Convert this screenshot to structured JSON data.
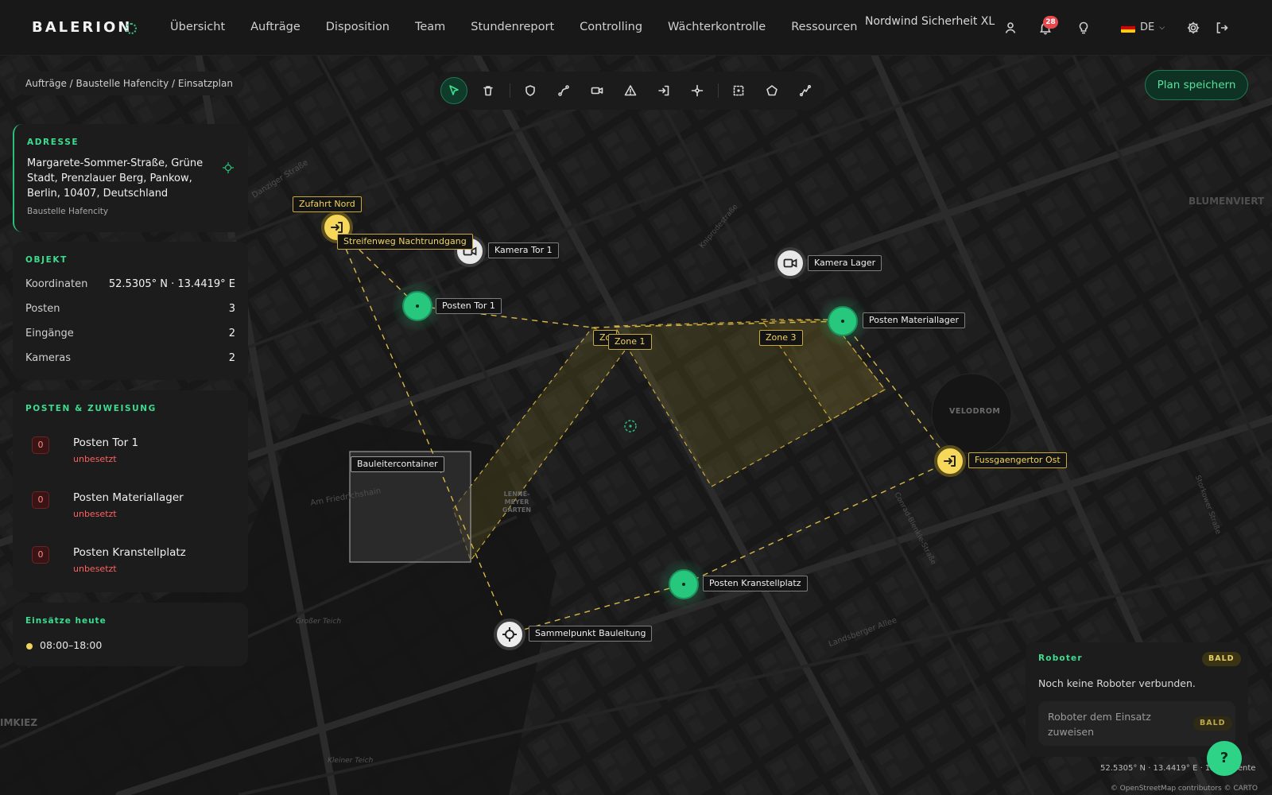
{
  "header": {
    "brand": "BALERION",
    "nav": [
      "Übersicht",
      "Aufträge",
      "Disposition",
      "Team",
      "Stundenreport",
      "Controlling",
      "Wächterkontrolle",
      "Ressourcen"
    ],
    "org_name": "Nordwind Sicherheit XL",
    "notification_count": "28",
    "language": "DE"
  },
  "breadcrumb": "Aufträge / Baustelle Hafencity / Einsatzplan",
  "toolbar": {
    "tools": [
      "select",
      "delete",
      "shield",
      "route",
      "camera",
      "warning",
      "entry",
      "crosshair",
      "dashed-select",
      "polygon",
      "line"
    ],
    "active": "select"
  },
  "save_button": "Plan speichern",
  "address": {
    "title": "ADRESSE",
    "text": "Margarete-Sommer-Straße, Grüne Stadt, Prenzlauer Berg, Pankow, Berlin, 10407, Deutschland",
    "subtitle": "Baustelle Hafencity"
  },
  "object": {
    "title": "OBJEKT",
    "rows": [
      {
        "key": "Koordinaten",
        "value": "52.5305° N · 13.4419° E"
      },
      {
        "key": "Posten",
        "value": "3"
      },
      {
        "key": "Eingänge",
        "value": "2"
      },
      {
        "key": "Kameras",
        "value": "2"
      }
    ]
  },
  "posts": {
    "title": "POSTEN & ZUWEISUNG",
    "items": [
      {
        "count": "0",
        "name": "Posten Tor 1",
        "status": "unbesetzt"
      },
      {
        "count": "0",
        "name": "Posten Materiallager",
        "status": "unbesetzt"
      },
      {
        "count": "0",
        "name": "Posten Kranstellplatz",
        "status": "unbesetzt"
      }
    ]
  },
  "today": {
    "title": "Einsätze heute",
    "time": "08:00–18:00"
  },
  "robot": {
    "title": "Roboter",
    "badge": "BALD",
    "message": "Noch keine Roboter verbunden.",
    "assign_label": "Roboter dem Einsatz zuweisen",
    "assign_badge": "BALD"
  },
  "map": {
    "coords": "52.5305° N · 13.4419° E · 13 Elemente",
    "attribution": "© OpenStreetMap contributors © CARTO",
    "place_labels": {
      "velodrom": "VELODROM",
      "blumenviertel": "BLUMENVIERT",
      "kiez": "IMKIEZ",
      "garten": "LENNÉ-MEYER GARTEN",
      "teich1": "Großer Teich",
      "teich2": "Kleiner Teich"
    },
    "streets": {
      "danziger": "Danziger Straße",
      "friedrichshain": "Am Friedrichshain",
      "landsberger": "Landsberger Allee",
      "conrad": "Conrad-Blenkle-Straße",
      "kniprode": "Kniprodestraße",
      "storkower": "Storkower Straße"
    },
    "markers": {
      "zufahrt_nord": "Zufahrt Nord",
      "streifenweg": "Streifenweg Nachtrundgang",
      "kamera_tor1": "Kamera Tor 1",
      "kamera_lager": "Kamera Lager",
      "posten_tor1": "Posten Tor 1",
      "posten_lager": "Posten Materiallager",
      "zone2": "Zo",
      "zone1": "Zone 1",
      "zone3": "Zone 3",
      "fussgaengertor": "Fussgaengertor Ost",
      "bauleitercontainer": "Bauleitercontainer",
      "posten_kran": "Posten Kranstellplatz",
      "sammelpunkt": "Sammelpunkt Bauleitung"
    }
  },
  "colors": {
    "accent": "#3ddc8e",
    "zone": "#caa83b",
    "danger": "#ff5f5f"
  }
}
